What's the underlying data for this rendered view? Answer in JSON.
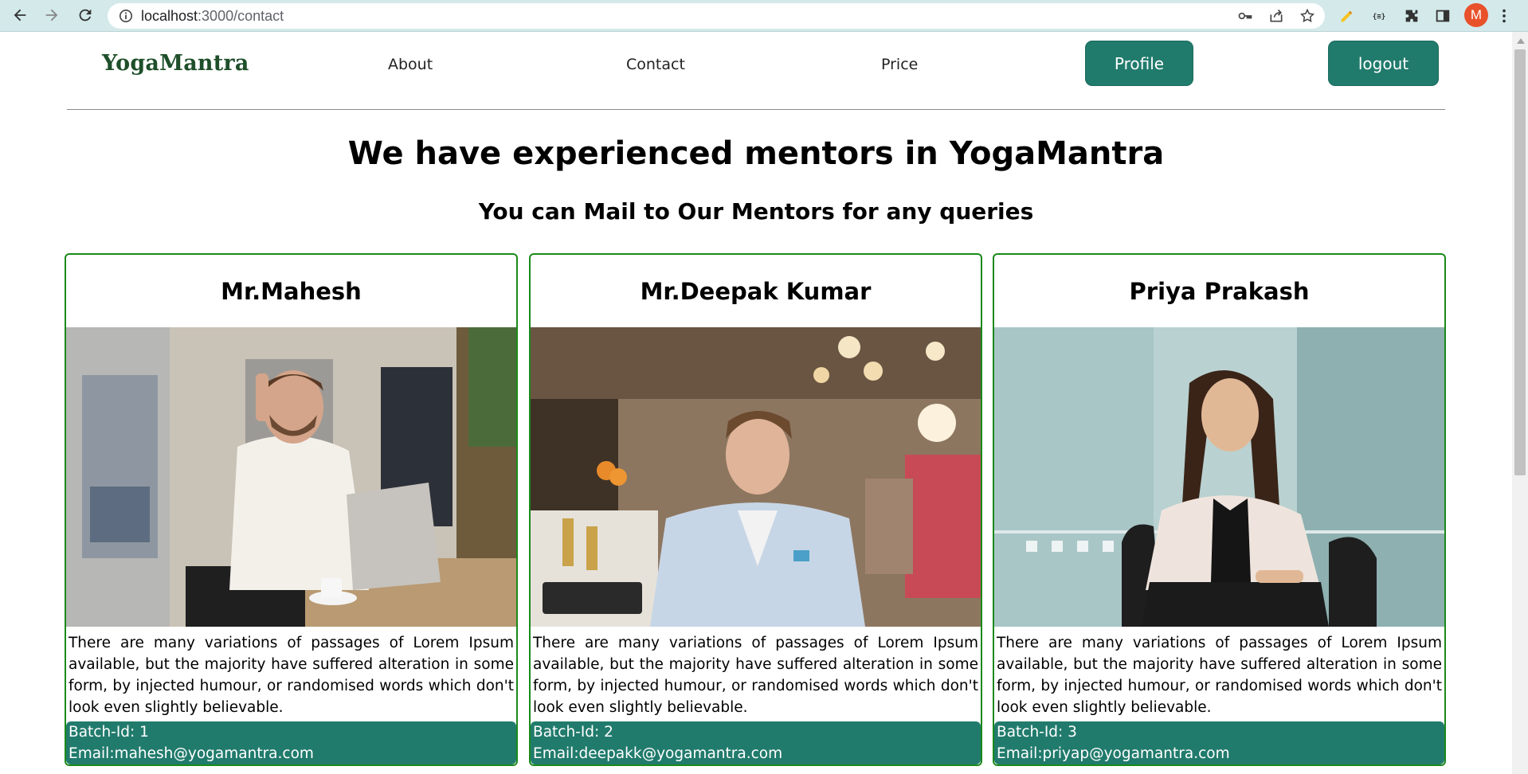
{
  "browser": {
    "url_host": "localhost",
    "url_path": ":3000/contact",
    "avatar_letter": "M"
  },
  "nav": {
    "brand": "YogaMantra",
    "links": [
      "About",
      "Contact",
      "Price"
    ],
    "profile_label": "Profile",
    "logout_label": "logout"
  },
  "page": {
    "title": "We have experienced mentors in YogaMantra",
    "subtitle": "You can Mail to Our Mentors for any queries"
  },
  "mentors": [
    {
      "name": "Mr.Mahesh",
      "description": "There are many variations of passages of Lorem Ipsum available, but the majority have suffered alteration in some form, by injected humour, or randomised words which don't look even slightly believable.",
      "batch": "Batch-Id: 1",
      "email": "Email:mahesh@yogamantra.com"
    },
    {
      "name": "Mr.Deepak Kumar",
      "description": "There are many variations of passages of Lorem Ipsum available, but the majority have suffered alteration in some form, by injected humour, or randomised words which don't look even slightly believable.",
      "batch": "Batch-Id: 2",
      "email": "Email:deepakk@yogamantra.com"
    },
    {
      "name": "Priya Prakash",
      "description": "There are many variations of passages of Lorem Ipsum available, but the majority have suffered alteration in some form, by injected humour, or randomised words which don't look even slightly believable.",
      "batch": "Batch-Id: 3",
      "email": "Email:priyap@yogamantra.com"
    }
  ],
  "colors": {
    "accent": "#217b6c",
    "brand": "#1e4f2a",
    "card_border": "#1a8a1a",
    "chrome": "#d3e9ea"
  }
}
